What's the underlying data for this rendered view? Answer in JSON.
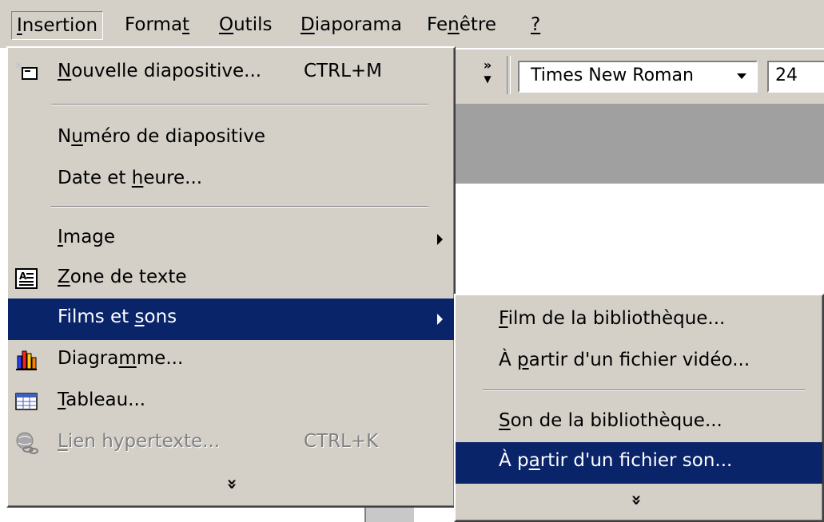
{
  "menubar": {
    "items": [
      {
        "label": "Insertion",
        "mn": "I",
        "rest": "nsertion"
      },
      {
        "label": "Format",
        "pre": "Forma",
        "mn": "t"
      },
      {
        "label": "Outils",
        "mn": "O",
        "rest": "utils"
      },
      {
        "label": "Diaporama",
        "mn": "D",
        "rest": "iaporama"
      },
      {
        "label": "Fenêtre",
        "pre": "Fe",
        "mn": "n",
        "rest": "être"
      },
      {
        "label": "?",
        "mn": "?"
      }
    ]
  },
  "toolbar": {
    "chevron": "»",
    "font_name": "Times New Roman",
    "font_size": "24"
  },
  "insert_menu": {
    "items": [
      {
        "label": "Nouvelle diapositive...",
        "pre": "",
        "mn": "N",
        "rest": "ouvelle diapositive...",
        "shortcut": "CTRL+M",
        "icon": "new-slide-icon"
      },
      {
        "label": "Numéro de diapositive",
        "pre": "N",
        "mn": "u",
        "rest": "méro de diapositive"
      },
      {
        "label": "Date et heure...",
        "pre": "Date et ",
        "mn": "h",
        "rest": "eure..."
      },
      {
        "label": "Image",
        "pre": "",
        "mn": "I",
        "rest": "mage",
        "submenu": true
      },
      {
        "label": "Zone de texte",
        "pre": "",
        "mn": "Z",
        "rest": "one de texte",
        "icon": "text-box-icon"
      },
      {
        "label": "Films et sons",
        "pre": "Films et ",
        "mn": "s",
        "rest": "ons",
        "submenu": true,
        "highlighted": true
      },
      {
        "label": "Diagramme...",
        "pre": "Diagra",
        "mn": "m",
        "rest": "me...",
        "icon": "chart-icon"
      },
      {
        "label": "Tableau...",
        "pre": "",
        "mn": "T",
        "rest": "ableau...",
        "icon": "table-icon"
      },
      {
        "label": "Lien hypertexte...",
        "pre": "",
        "mn": "L",
        "rest": "ien hypertexte...",
        "shortcut": "CTRL+K",
        "icon": "hyperlink-icon",
        "disabled": true
      }
    ],
    "more": "»"
  },
  "movies_submenu": {
    "items": [
      {
        "label": "Film de la bibliothèque...",
        "pre": "",
        "mn": "F",
        "rest": "ilm de la bibliothèque..."
      },
      {
        "label": "À partir d'un fichier vidéo...",
        "pre": "À ",
        "mn": "p",
        "rest": "artir d'un fichier vidéo..."
      },
      {
        "label": "Son de la bibliothèque...",
        "pre": "",
        "mn": "S",
        "rest": "on de la bibliothèque..."
      },
      {
        "label": "À partir d'un fichier son...",
        "pre": "À p",
        "mn": "a",
        "rest": "rtir d'un fichier son...",
        "highlighted": true
      }
    ],
    "more": "»"
  },
  "colors": {
    "menu_bg": "#d4d0c8",
    "highlight": "#0a246a",
    "disabled": "#808080"
  }
}
